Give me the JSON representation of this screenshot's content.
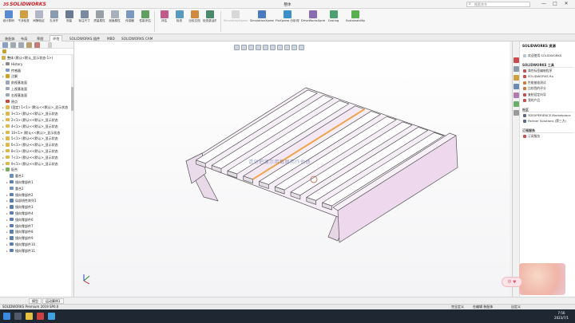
{
  "window": {
    "logo_text": "SOLIDWORKS",
    "title": "整体",
    "search_placeholder": "搜索命令",
    "controls": [
      "—",
      "□",
      "✕"
    ]
  },
  "ribbon": {
    "buttons": [
      "设计算例",
      "干涉检查",
      "间隙验证",
      "孔对齐",
      "测量",
      "标注尺寸",
      "质量属性",
      "剖面属性",
      "传感器",
      "性能评估",
      "评估",
      "检查",
      "比较文档",
      "检查激活的文档"
    ],
    "simulation_items": [
      "SimulationXpress 分析向导",
      "FloXpress 分析向导",
      "DriveWorksXpress 向导",
      "Costing",
      "Sustainability"
    ],
    "disabled_item": "SimulationXpress 分析向导"
  },
  "tabs": [
    "装配体",
    "布局",
    "草图",
    "评估",
    "SOLIDWORKS 插件",
    "MBD",
    "SOLIDWORKS CAM"
  ],
  "active_tab": "评估",
  "tree": {
    "root": "整体 (默认<默认_显示状态-1>)",
    "items": [
      {
        "label": "History",
        "icon": "history-icon",
        "color": "#8a8a8a",
        "expand": "▸"
      },
      {
        "label": "传感器",
        "icon": "sensor-icon",
        "color": "#7a9cc6",
        "expand": ""
      },
      {
        "label": "注解",
        "icon": "annotation-icon",
        "color": "#d4a020",
        "expand": "▸"
      },
      {
        "label": "前视基准面",
        "icon": "plane-icon",
        "color": "#9aa8b8",
        "expand": ""
      },
      {
        "label": "上视基准面",
        "icon": "plane-icon",
        "color": "#9aa8b8",
        "expand": ""
      },
      {
        "label": "右视基准面",
        "icon": "plane-icon",
        "color": "#9aa8b8",
        "expand": ""
      },
      {
        "label": "原点",
        "icon": "origin-icon",
        "color": "#c94a3a",
        "expand": ""
      },
      {
        "label": "(固定) 1<1> (默认<<默认>_显示状态",
        "icon": "part-icon",
        "color": "#e0b84a",
        "expand": "▸"
      },
      {
        "label": "3<1> (默认<<默认>_显示状态",
        "icon": "part-icon",
        "color": "#e0b84a",
        "expand": "▸"
      },
      {
        "label": "2<1> (默认<<默认>_显示状态",
        "icon": "part-icon",
        "color": "#e0b84a",
        "expand": "▸"
      },
      {
        "label": "4<1> (默认<<默认>_显示状态",
        "icon": "part-icon",
        "color": "#e0b84a",
        "expand": "▸"
      },
      {
        "label": "10<1> (默认<<默认>_显示状态",
        "icon": "part-icon",
        "color": "#e0b84a",
        "expand": "▸"
      },
      {
        "label": "5<1> (默认<<默认>_显示状态",
        "icon": "part-icon",
        "color": "#e0b84a",
        "expand": "▸"
      },
      {
        "label": "6<1> (默认<<默认>_显示状态",
        "icon": "part-icon",
        "color": "#e0b84a",
        "expand": "▸"
      },
      {
        "label": "8<1> (默认<<默认>_显示状态",
        "icon": "part-icon",
        "color": "#e0b84a",
        "expand": "▸"
      },
      {
        "label": "7<1> (默认<<默认>_显示状态",
        "icon": "part-icon",
        "color": "#e0b84a",
        "expand": "▸"
      },
      {
        "label": "9<1> (默认<<默认>_显示状态",
        "icon": "part-icon",
        "color": "#e0b84a",
        "expand": "▸"
      },
      {
        "label": "配合",
        "icon": "mate-icon",
        "color": "#7ab05a",
        "expand": "▾"
      },
      {
        "label": "重合1",
        "icon": "coincident-icon",
        "color": "#6a8fc0",
        "expand": ""
      },
      {
        "label": "镜向零部件1",
        "icon": "mirror-icon",
        "color": "#5a7fb0",
        "expand": "▸"
      },
      {
        "label": "重合2",
        "icon": "coincident-icon",
        "color": "#6a8fc0",
        "expand": ""
      },
      {
        "label": "镜向零部件2",
        "icon": "mirror-icon",
        "color": "#5a7fb0",
        "expand": "▸"
      },
      {
        "label": "局部线性阵列1",
        "icon": "pattern-icon",
        "color": "#5a7fb0",
        "expand": "▸"
      },
      {
        "label": "镜向零部件3",
        "icon": "mirror-icon",
        "color": "#5a7fb0",
        "expand": "▸"
      },
      {
        "label": "镜向零部件4",
        "icon": "mirror-icon",
        "color": "#5a7fb0",
        "expand": "▸"
      },
      {
        "label": "镜向零部件6",
        "icon": "mirror-icon",
        "color": "#5a7fb0",
        "expand": "▸"
      },
      {
        "label": "镜向零部件7",
        "icon": "mirror-icon",
        "color": "#5a7fb0",
        "expand": "▸"
      },
      {
        "label": "镜向零部件8",
        "icon": "mirror-icon",
        "color": "#5a7fb0",
        "expand": "▸"
      },
      {
        "label": "镜向零部件9",
        "icon": "mirror-icon",
        "color": "#5a7fb0",
        "expand": "▸"
      },
      {
        "label": "镜向零部件10",
        "icon": "mirror-icon",
        "color": "#5a7fb0",
        "expand": "▸"
      },
      {
        "label": "镜向零部件11",
        "icon": "mirror-icon",
        "color": "#5a7fb0",
        "expand": "▸"
      }
    ]
  },
  "viewport": {
    "watermark": "请勿把演示用截图用作他途",
    "part_color": "#f3e8f3",
    "selected_color": "#f0a44a"
  },
  "model_tabs": [
    "模型",
    "运动算例1"
  ],
  "status": {
    "left": "SOLIDWORKS Premium 2019 SP0.0",
    "items": [
      "完全定义",
      "在编辑 装配体",
      "自定义"
    ]
  },
  "taskpane": {
    "title": "SOLIDWORKS 资源",
    "top_item": "欢迎使用 SOLIDWORKS",
    "tools_header": "SOLIDWORKS 工具",
    "tools": [
      "属性标签编制程序",
      "SOLIDWORKS Rx",
      "性能基准测试",
      "比较我的评分",
      "复制设定向导",
      "我的产品"
    ],
    "community_header": "社区",
    "community": [
      "3DEXPERIENCE Marketplace",
      "Partner Solutions (第三方)"
    ],
    "subscription_header": "订阅服务",
    "subscription": [
      "订阅服务"
    ]
  },
  "avatar_chip": "中 ♥",
  "taskbar": {
    "time": "7:56",
    "date": "2023/7/1"
  }
}
